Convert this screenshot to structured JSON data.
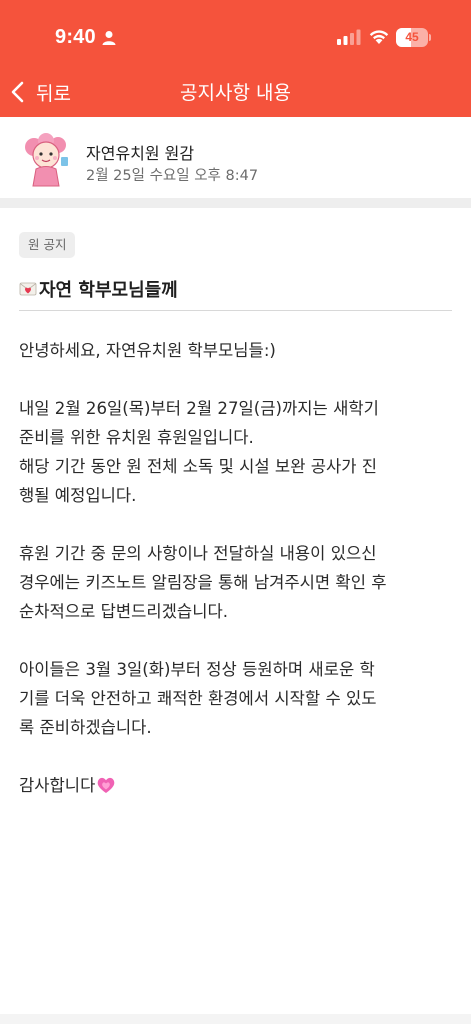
{
  "status_bar": {
    "time": "9:40",
    "battery": "45"
  },
  "nav": {
    "back_label": "뒤로",
    "title": "공지사항 내용"
  },
  "author": {
    "name": "자연유치원 원감",
    "date": "2월 25일 수요일 오후 8:47"
  },
  "post": {
    "tag": "원 공지",
    "title": "자연 학부모님들께",
    "paragraphs": [
      "안녕하세요, 자연유치원 학부모님들:)",
      "내일 2월 26일(목)부터 2월 27일(금)까지는 새학기\n준비를 위한 유치원 휴원일입니다.\n해당 기간 동안 원 전체 소독 및 시설 보완 공사가 진\n행될 예정입니다.",
      "휴원 기간 중 문의 사항이나 전달하실 내용이 있으신\n경우에는 키즈노트 알림장을 통해 남겨주시면 확인 후\n순차적으로 답변드리겠습니다.",
      "아이들은 3월 3일(화)부터 정상 등원하며 새로운 학\n기를 더욱 안전하고 쾌적한 환경에서 시작할 수 있도\n록 준비하겠습니다.",
      "감사합니다"
    ]
  },
  "colors": {
    "header_bg": "#f5533c",
    "tag_bg": "#eeeeee"
  },
  "icons": [
    "person-icon",
    "signal-icon",
    "wifi-icon",
    "battery-icon",
    "back-chevron-icon",
    "avatar",
    "envelope-icon",
    "heart-icon"
  ]
}
